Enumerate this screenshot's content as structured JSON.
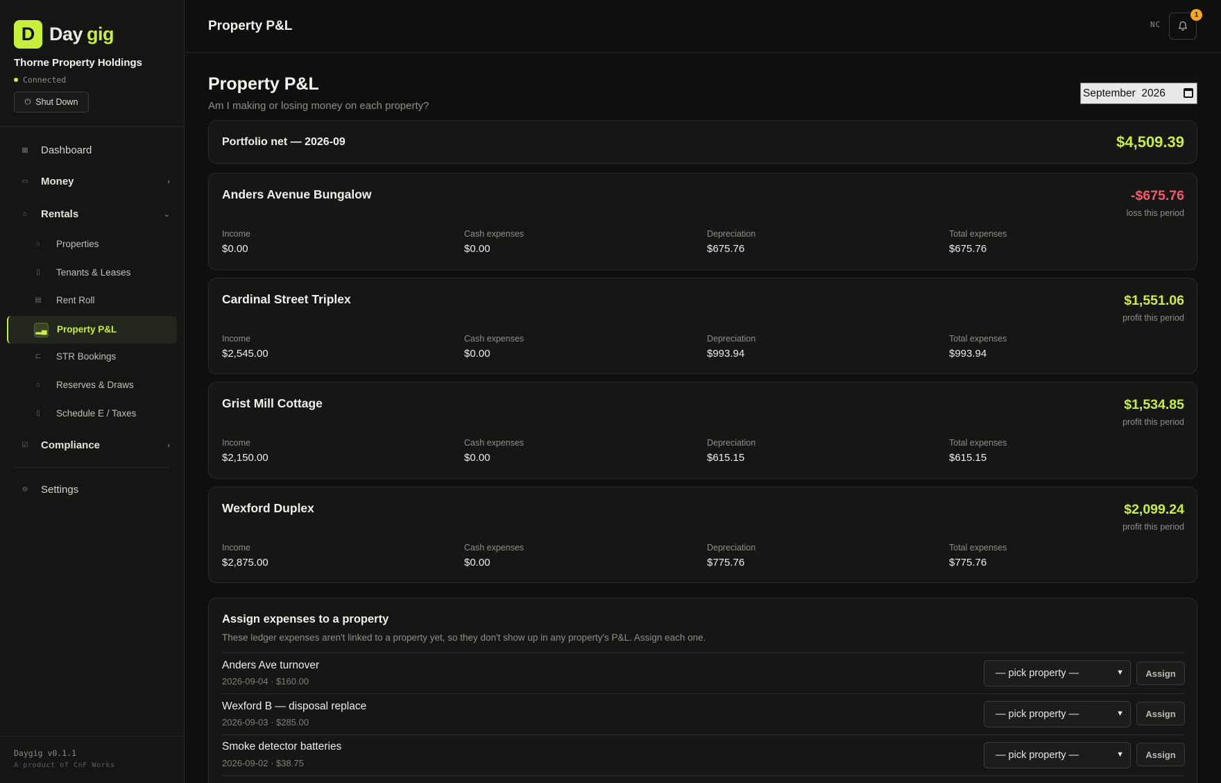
{
  "brand": {
    "logo_letter": "D",
    "name_main": "Day",
    "name_accent": "gig",
    "accent_color": "#c8ef3c"
  },
  "org": {
    "name": "Thorne Property Holdings",
    "status": "Connected",
    "shutdown_label": "Shut Down"
  },
  "nav": {
    "dashboard": "Dashboard",
    "money": "Money",
    "rentals": "Rentals",
    "rentals_sub": [
      "Properties",
      "Tenants & Leases",
      "Rent Roll",
      "Property P&L",
      "STR Bookings",
      "Reserves & Draws",
      "Schedule E / Taxes"
    ],
    "compliance": "Compliance",
    "settings": "Settings",
    "active_item": "Property P&L"
  },
  "footer": {
    "version": "Daygig v0.1.1",
    "credit": "A product of CnF Works"
  },
  "topbar": {
    "title": "Property P&L",
    "user_initials": "NC",
    "notification_count": "1"
  },
  "page": {
    "title": "Property P&L",
    "subtitle": "Am I making or losing money on each property?",
    "month_value": "September  2026"
  },
  "portfolio": {
    "label": "Portfolio net — 2026-09",
    "net": "$4,509.39"
  },
  "metric_labels": {
    "income": "Income",
    "cash_expenses": "Cash expenses",
    "depreciation": "Depreciation",
    "total_expenses": "Total expenses"
  },
  "properties": [
    {
      "name": "Anders Avenue Bungalow",
      "net": "-$675.76",
      "tag": "loss this period",
      "income": "$0.00",
      "cash_expenses": "$0.00",
      "depreciation": "$675.76",
      "total_expenses": "$675.76"
    },
    {
      "name": "Cardinal Street Triplex",
      "net": "$1,551.06",
      "tag": "profit this period",
      "income": "$2,545.00",
      "cash_expenses": "$0.00",
      "depreciation": "$993.94",
      "total_expenses": "$993.94"
    },
    {
      "name": "Grist Mill Cottage",
      "net": "$1,534.85",
      "tag": "profit this period",
      "income": "$2,150.00",
      "cash_expenses": "$0.00",
      "depreciation": "$615.15",
      "total_expenses": "$615.15"
    },
    {
      "name": "Wexford Duplex",
      "net": "$2,099.24",
      "tag": "profit this period",
      "income": "$2,875.00",
      "cash_expenses": "$0.00",
      "depreciation": "$775.76",
      "total_expenses": "$775.76"
    }
  ],
  "assign": {
    "title": "Assign expenses to a property",
    "description": "These ledger expenses aren't linked to a property yet, so they don't show up in any property's P&L. Assign each one.",
    "select_placeholder": "— pick property —",
    "button_label": "Assign",
    "expenses": [
      {
        "name": "Anders Ave turnover",
        "meta": "2026-09-04 · $160.00"
      },
      {
        "name": "Wexford B — disposal replace",
        "meta": "2026-09-03 · $285.00"
      },
      {
        "name": "Smoke detector batteries",
        "meta": "2026-09-02 · $38.75"
      }
    ]
  }
}
